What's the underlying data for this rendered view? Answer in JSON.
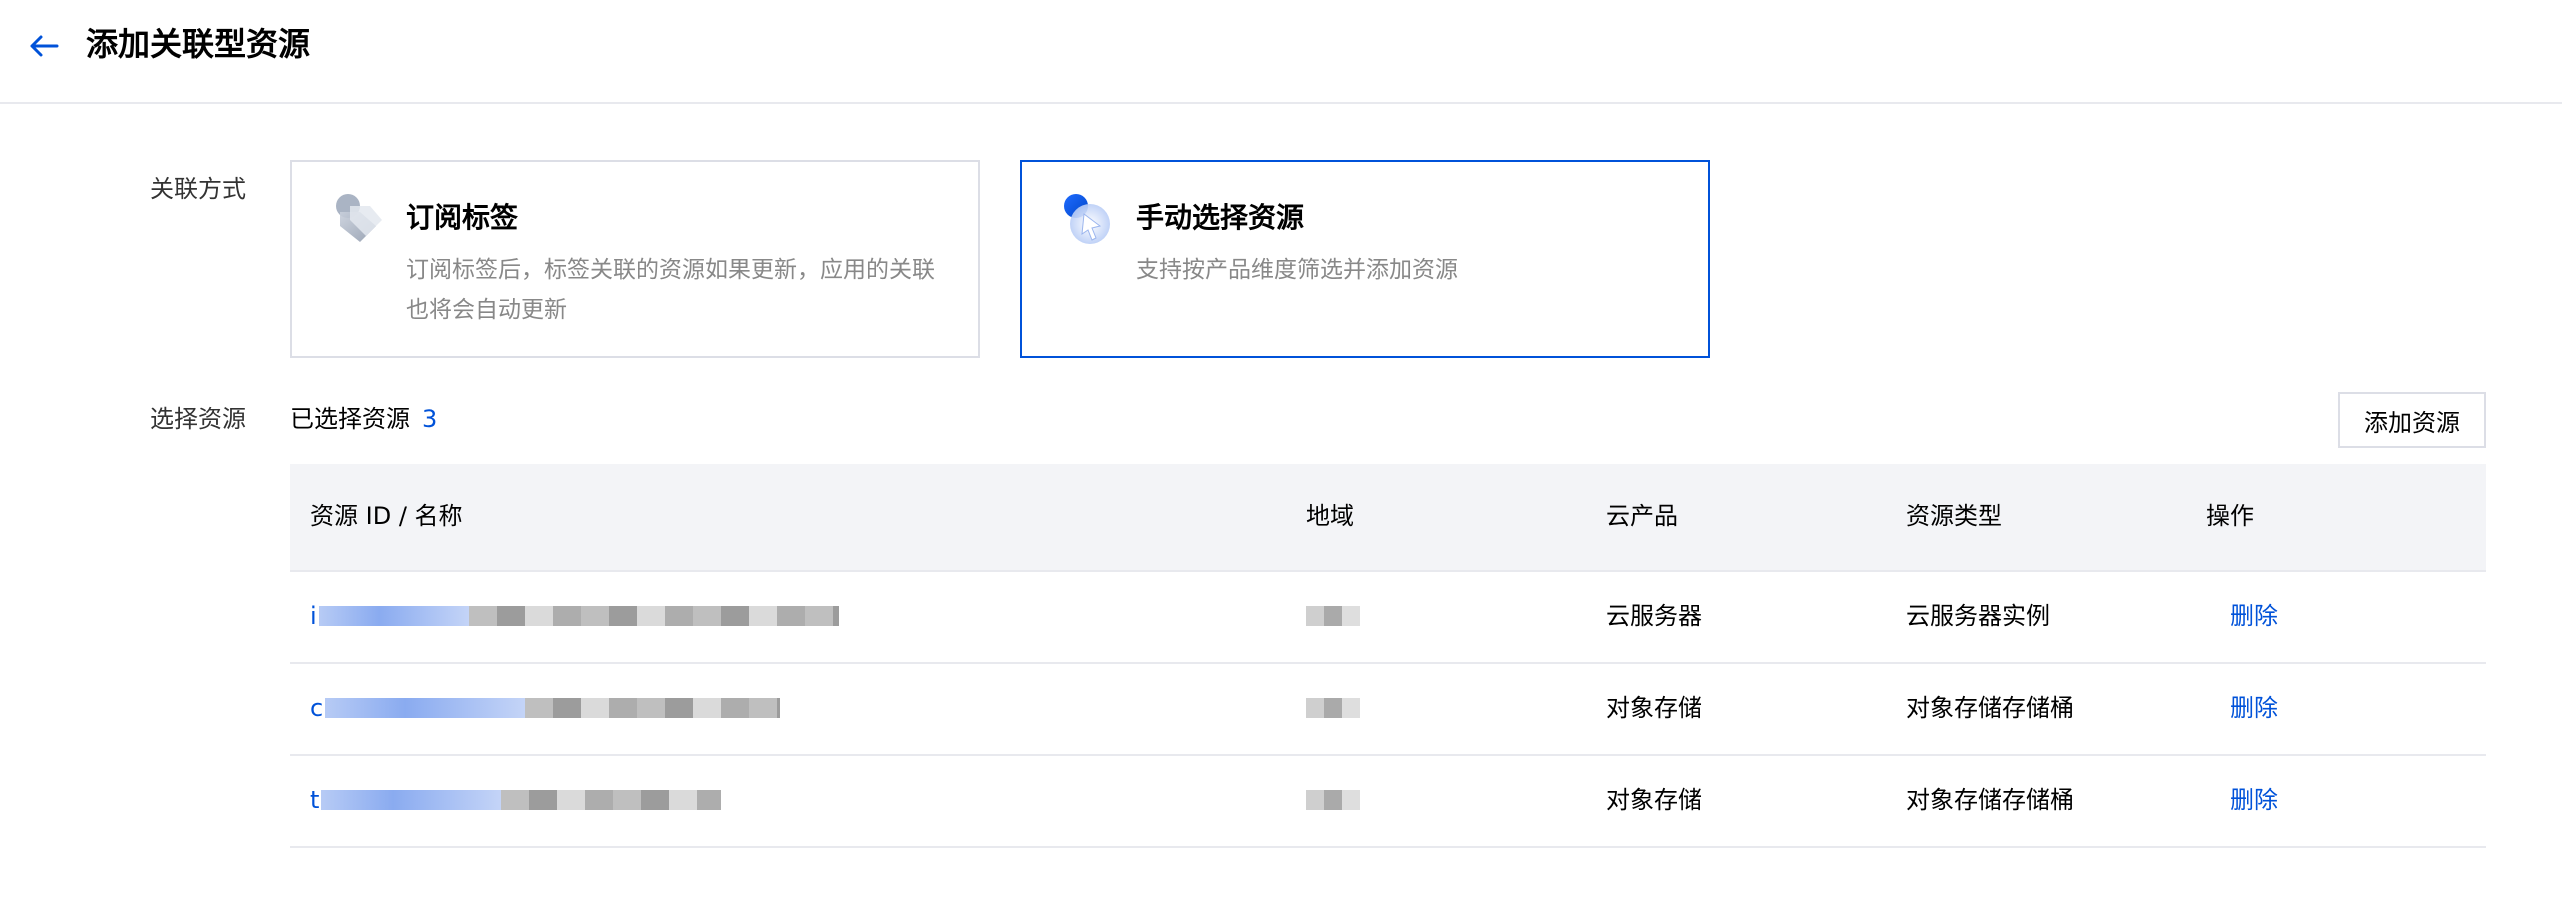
{
  "header": {
    "title": "添加关联型资源"
  },
  "form": {
    "association_label": "关联方式",
    "select_label": "选择资源"
  },
  "cards": [
    {
      "title": "订阅标签",
      "desc": "订阅标签后，标签关联的资源如果更新，应用的关联也将会自动更新",
      "selected": false
    },
    {
      "title": "手动选择资源",
      "desc": "支持按产品维度筛选并添加资源",
      "selected": true
    }
  ],
  "selection": {
    "label": "已选择资源",
    "count": "3",
    "add_button": "添加资源"
  },
  "table": {
    "columns": [
      "资源 ID / 名称",
      "地域",
      "云产品",
      "资源类型",
      "操作"
    ],
    "rows": [
      {
        "id_prefix": "i",
        "product": "云服务器",
        "type": "云服务器实例",
        "action": "删除"
      },
      {
        "id_prefix": "c",
        "product": "对象存储",
        "type": "对象存储存储桶",
        "action": "删除"
      },
      {
        "id_prefix": "t",
        "product": "对象存储",
        "type": "对象存储存储桶",
        "action": "删除"
      }
    ]
  },
  "colors": {
    "accent": "#0052d9",
    "border": "#dcdee6",
    "table_header_bg": "#f3f4f7"
  },
  "icons": {
    "back": "arrow-left-icon",
    "tag": "tag-icon",
    "manual": "cursor-select-icon"
  }
}
